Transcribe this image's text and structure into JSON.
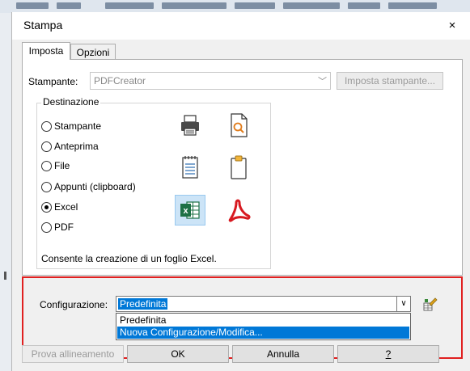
{
  "window": {
    "title": "Stampa",
    "close_glyph": "×"
  },
  "tabs": [
    {
      "label": "Imposta",
      "active": true
    },
    {
      "label": "Opzioni",
      "active": false
    }
  ],
  "printer": {
    "label": "Stampante:",
    "value": "PDFCreator",
    "setup_button": "Imposta stampante..."
  },
  "destination": {
    "title": "Destinazione",
    "options": [
      {
        "label": "Stampante",
        "checked": false
      },
      {
        "label": "Anteprima",
        "checked": false
      },
      {
        "label": "File",
        "checked": false
      },
      {
        "label": "Appunti (clipboard)",
        "checked": false
      },
      {
        "label": "Excel",
        "checked": true
      },
      {
        "label": "PDF",
        "checked": false
      }
    ],
    "icons": [
      "printer-icon",
      "preview-icon",
      "file-icon",
      "clipboard-icon",
      "excel-icon",
      "pdf-icon"
    ],
    "description": "Consente la creazione di un foglio Excel."
  },
  "configuration": {
    "label": "Configurazione:",
    "selected": "Predefinita",
    "dropdown_options": [
      "Predefinita",
      "Nuova Configurazione/Modifica..."
    ],
    "highlighted_index": 1
  },
  "buttons": {
    "align": "Prova allineamento",
    "ok": "OK",
    "cancel": "Annulla",
    "help": "?"
  },
  "colors": {
    "accent": "#0078d7",
    "highlight_frame": "#e02020"
  }
}
